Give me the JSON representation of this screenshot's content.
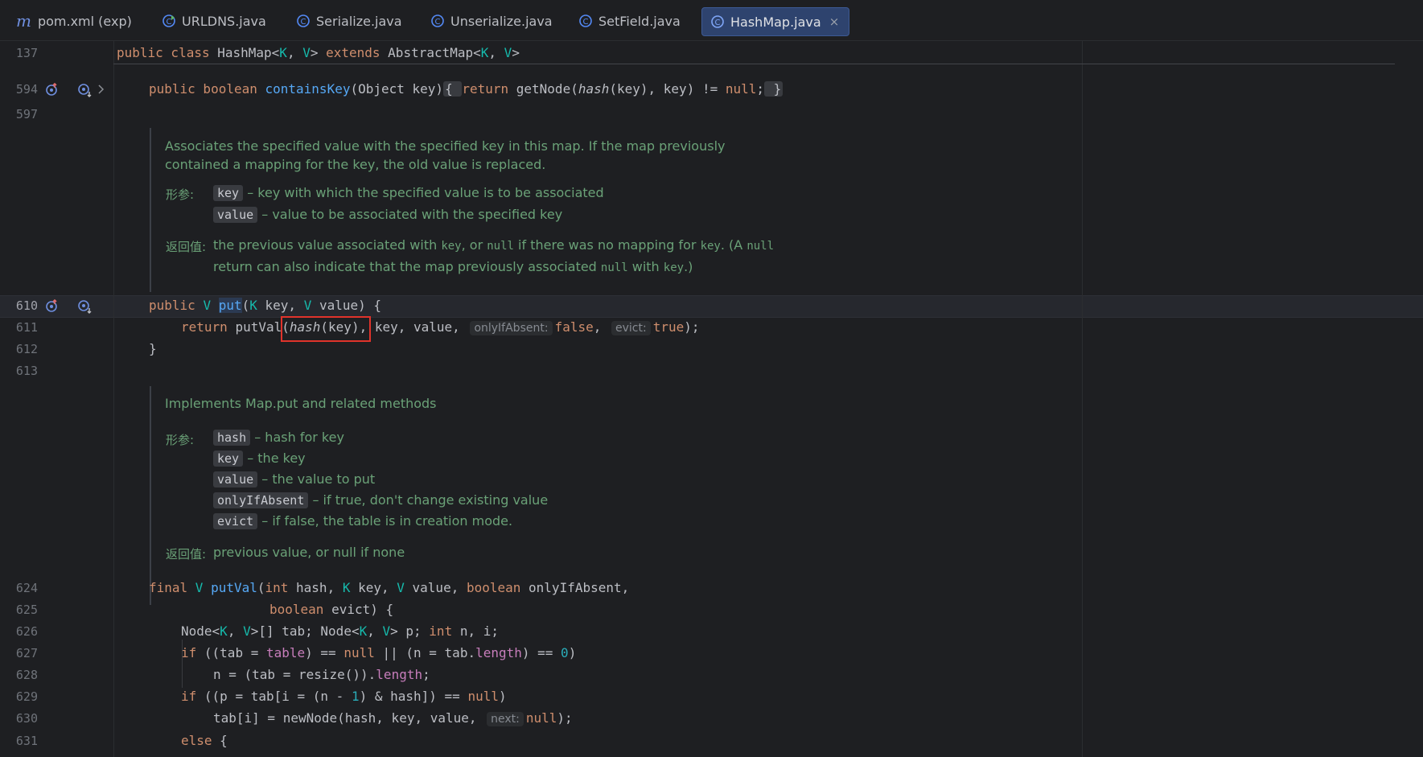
{
  "tabs": [
    {
      "label": "pom.xml (exp)",
      "icon": "maven-icon"
    },
    {
      "label": "URLDNS.java",
      "icon": "class-run-icon"
    },
    {
      "label": "Serialize.java",
      "icon": "class-icon"
    },
    {
      "label": "Unserialize.java",
      "icon": "class-icon"
    },
    {
      "label": "SetField.java",
      "icon": "class-icon"
    },
    {
      "label": "HashMap.java",
      "icon": "class-icon",
      "active": true
    }
  ],
  "maven_glyph": "m",
  "close_glyph": "×",
  "sticky": {
    "line": "137"
  },
  "lines": {
    "l594": "594",
    "l597": "597",
    "l610": "610",
    "l611": "611",
    "l612": "612",
    "l613": "613",
    "l624": "624",
    "l625": "625",
    "l626": "626",
    "l627": "627",
    "l628": "628",
    "l629": "629",
    "l630": "630",
    "l631": "631"
  },
  "doc1": {
    "summary": "Associates the specified value with the specified key in this map. If the map previously contained a mapping for the key, the old value is replaced.",
    "params_label": "形参:",
    "params": [
      {
        "name": "key",
        "desc": "– key with which the specified value is to be associated"
      },
      {
        "name": "value",
        "desc": "– value to be associated with the specified key"
      }
    ],
    "returns_label": "返回值:",
    "returns_part1": "the previous value associated with ",
    "returns_code1": "key",
    "returns_part2": ", or ",
    "returns_code2": "null",
    "returns_part3": " if there was no mapping for ",
    "returns_code3": "key",
    "returns_part4": ". (A ",
    "returns_code4": "null",
    "returns_line2_part1": "return can also indicate that the map previously associated ",
    "returns_line2_code1": "null",
    "returns_line2_part2": " with ",
    "returns_line2_code2": "key",
    "returns_line2_part3": ".)"
  },
  "doc2": {
    "summary": "Implements Map.put and related methods",
    "params_label": "形参:",
    "params": [
      {
        "name": "hash",
        "desc": "– hash for key"
      },
      {
        "name": "key",
        "desc": "– the key"
      },
      {
        "name": "value",
        "desc": "– the value to put"
      },
      {
        "name": "onlyIfAbsent",
        "desc": "– if true, don't change existing value"
      },
      {
        "name": "evict",
        "desc": "– if false, the table is in creation mode."
      }
    ],
    "returns_label": "返回值:",
    "returns": "previous value, or null if none"
  },
  "hints": {
    "onlyIfAbsent": "onlyIfAbsent:",
    "evict": "evict:",
    "next": "next:"
  },
  "colors": {
    "keyword": "#cf8e6d",
    "type": "#16baac",
    "function": "#56a8f5",
    "doc": "#6aa177",
    "highlight_box": "#e0332b"
  }
}
